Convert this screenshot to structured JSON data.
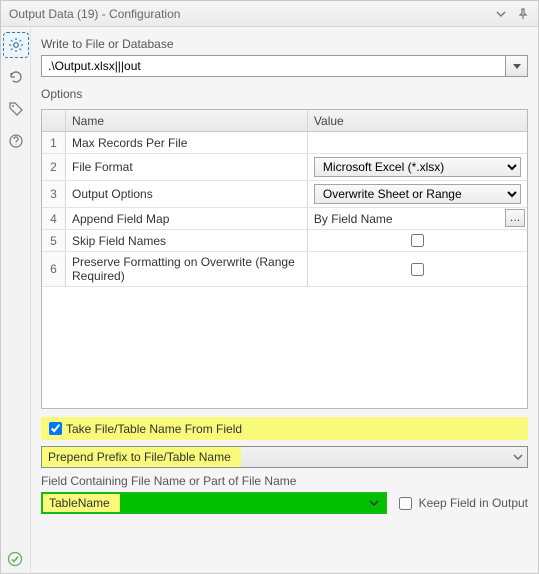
{
  "title": "Output Data (19) - Configuration",
  "writeLabel": "Write to File or Database",
  "filePath": ".\\Output.xlsx|||out",
  "optionsLabel": "Options",
  "headers": {
    "name": "Name",
    "value": "Value"
  },
  "rows": {
    "r1": {
      "idx": "1",
      "name": "Max Records Per File",
      "type": "blank"
    },
    "r2": {
      "idx": "2",
      "name": "File Format",
      "type": "select",
      "value": "Microsoft Excel (*.xlsx)"
    },
    "r3": {
      "idx": "3",
      "name": "Output Options",
      "type": "select",
      "value": "Overwrite Sheet or Range"
    },
    "r4": {
      "idx": "4",
      "name": "Append Field Map",
      "type": "textbtn",
      "value": "By Field Name"
    },
    "r5": {
      "idx": "5",
      "name": "Skip Field Names",
      "type": "check",
      "checked": false
    },
    "r6": {
      "idx": "6",
      "name": "Preserve Formatting on Overwrite (Range Required)",
      "type": "check",
      "checked": false
    }
  },
  "takeFromField": {
    "label": "Take File/Table Name From Field",
    "checked": true
  },
  "actionCombo": "Prepend Prefix to File/Table Name",
  "fieldContainingLabel": "Field Containing File Name or Part of File Name",
  "fieldName": "TableName",
  "keepField": {
    "label": "Keep Field in Output",
    "checked": false
  }
}
